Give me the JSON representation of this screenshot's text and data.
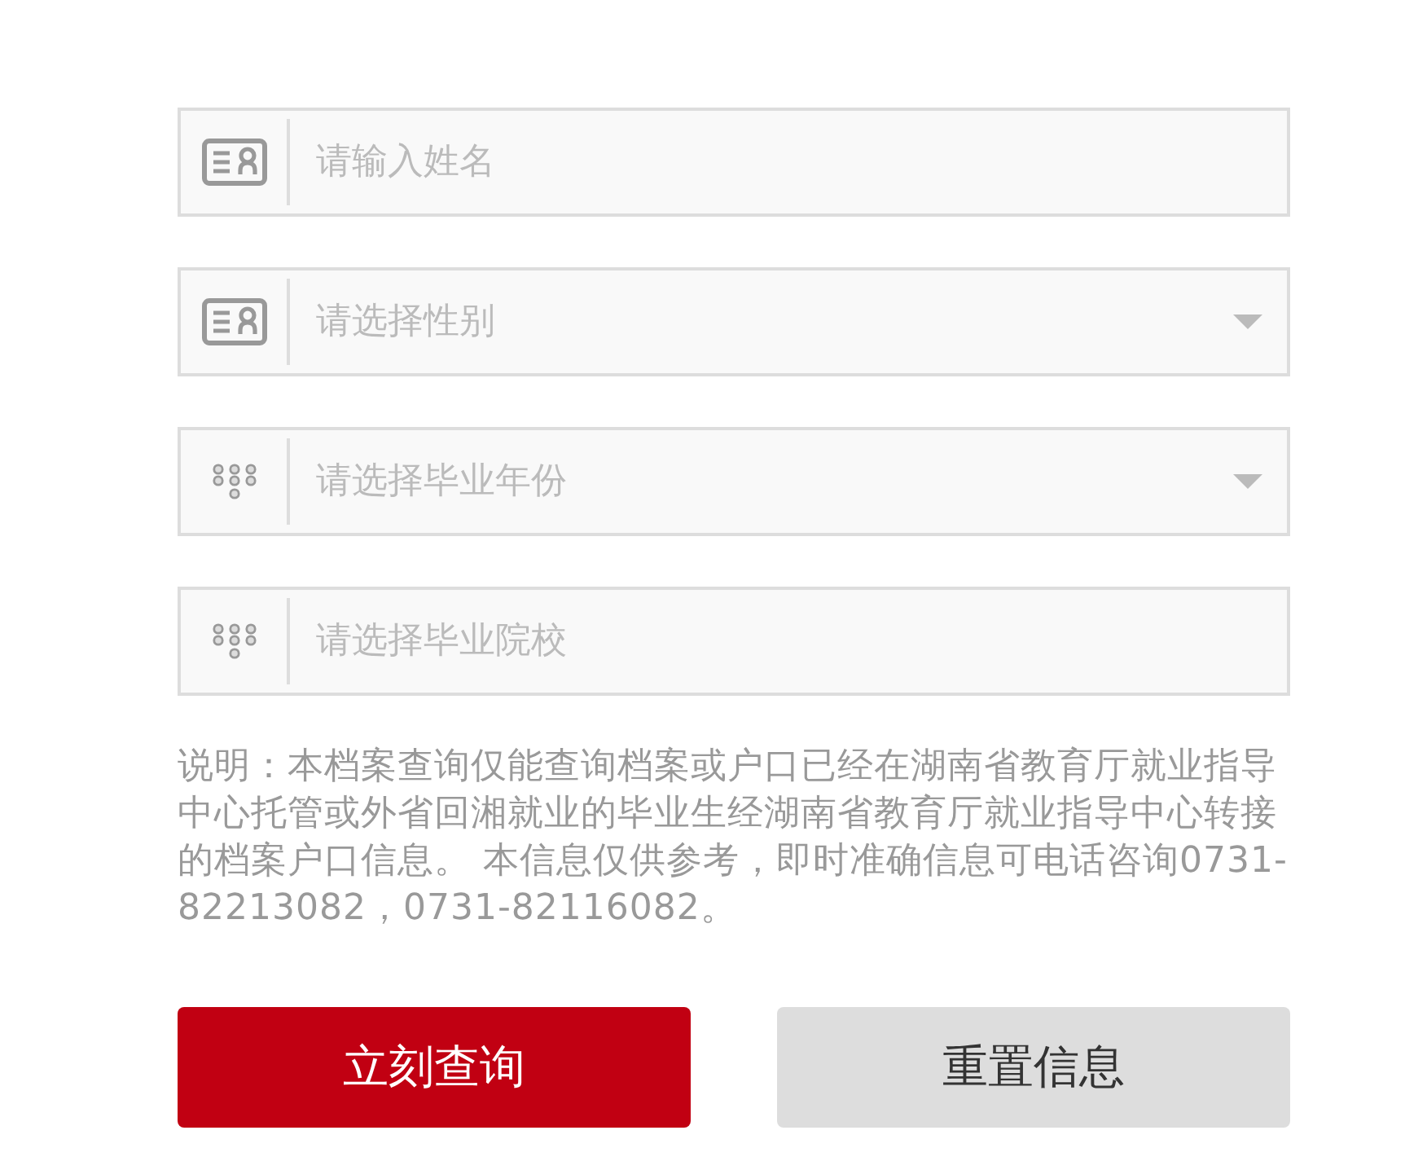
{
  "form": {
    "fields": [
      {
        "kind": "input",
        "placeholder": "请输入姓名"
      },
      {
        "kind": "select",
        "placeholder": "请选择性别"
      },
      {
        "kind": "select",
        "placeholder": "请选择毕业年份"
      },
      {
        "kind": "input",
        "placeholder": "请选择毕业院校"
      }
    ]
  },
  "note": "说明：本档案查询仅能查询档案或户口已经在湖南省教育厅就业指导中心托管或外省回湘就业的毕业生经湖南省教育厅就业指导中心转接的档案户口信息。 本信息仅供参考，即时准确信息可电话咨询0731-82213082，0731-82116082。",
  "buttons": [
    {
      "kind": "primary",
      "label": "立刻查询"
    },
    {
      "kind": "secondary",
      "label": "重置信息"
    }
  ]
}
